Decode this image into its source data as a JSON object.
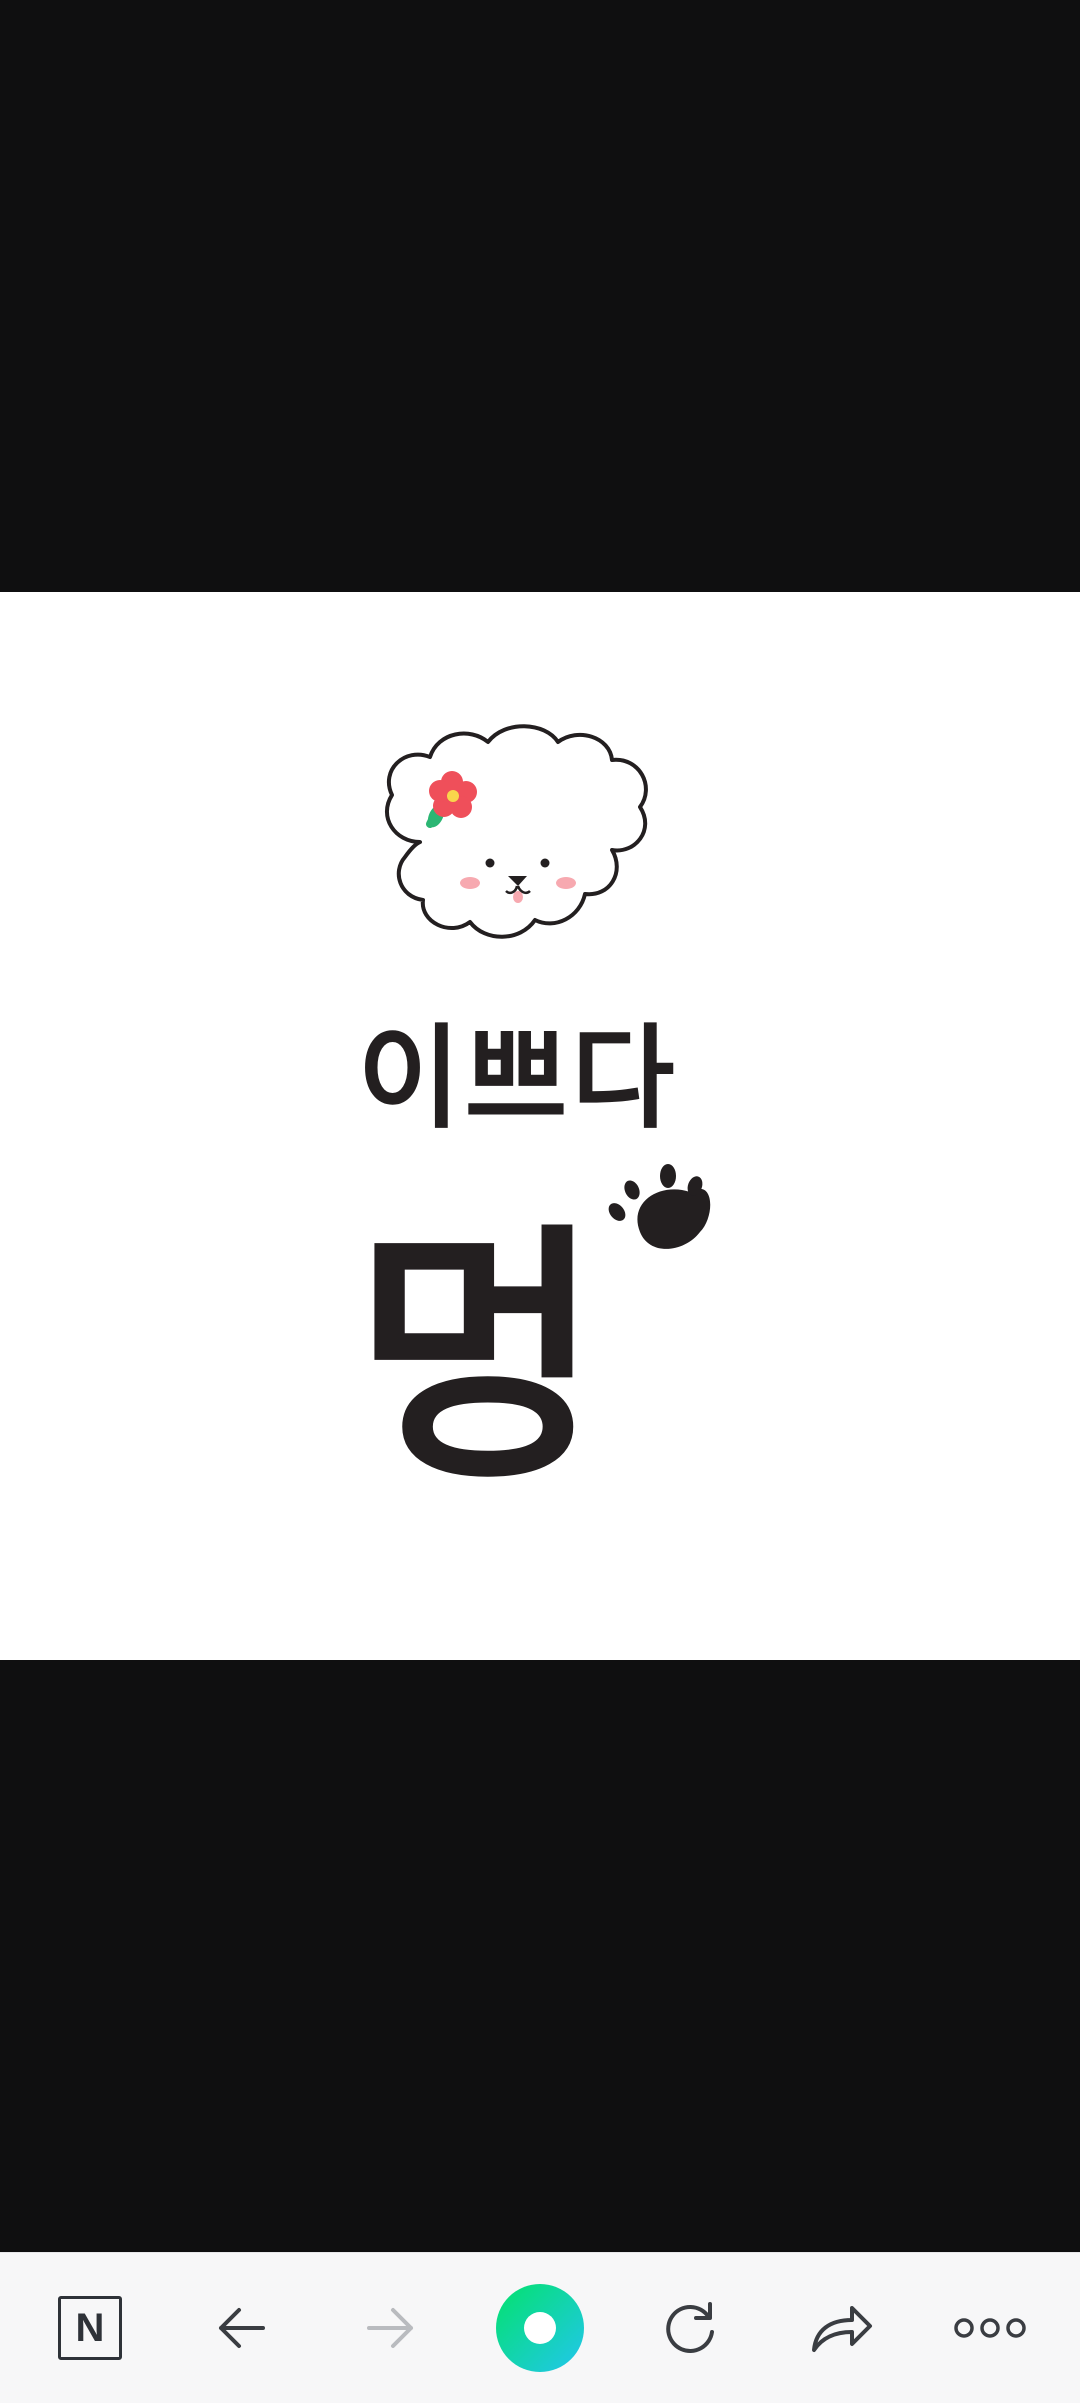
{
  "image": {
    "sticker_text_line1": "이쁘다",
    "sticker_text_line2": "멍",
    "colors": {
      "background_dark": "#0f0f10",
      "panel": "#ffffff",
      "ink": "#231f20",
      "flower": "#ef4f5a",
      "leaf": "#2bb673",
      "cheek": "#f7a9b0"
    }
  },
  "toolbar": {
    "naver_label": "N",
    "icons": [
      "naver-n-icon",
      "back-arrow-icon",
      "forward-arrow-icon",
      "green-dot-icon",
      "refresh-icon",
      "share-icon",
      "more-icon"
    ],
    "colors": {
      "icon": "#3a3d42",
      "disabled": "#b9bbbf",
      "green_start": "#03e26c",
      "green_end": "#22c6ee"
    }
  }
}
